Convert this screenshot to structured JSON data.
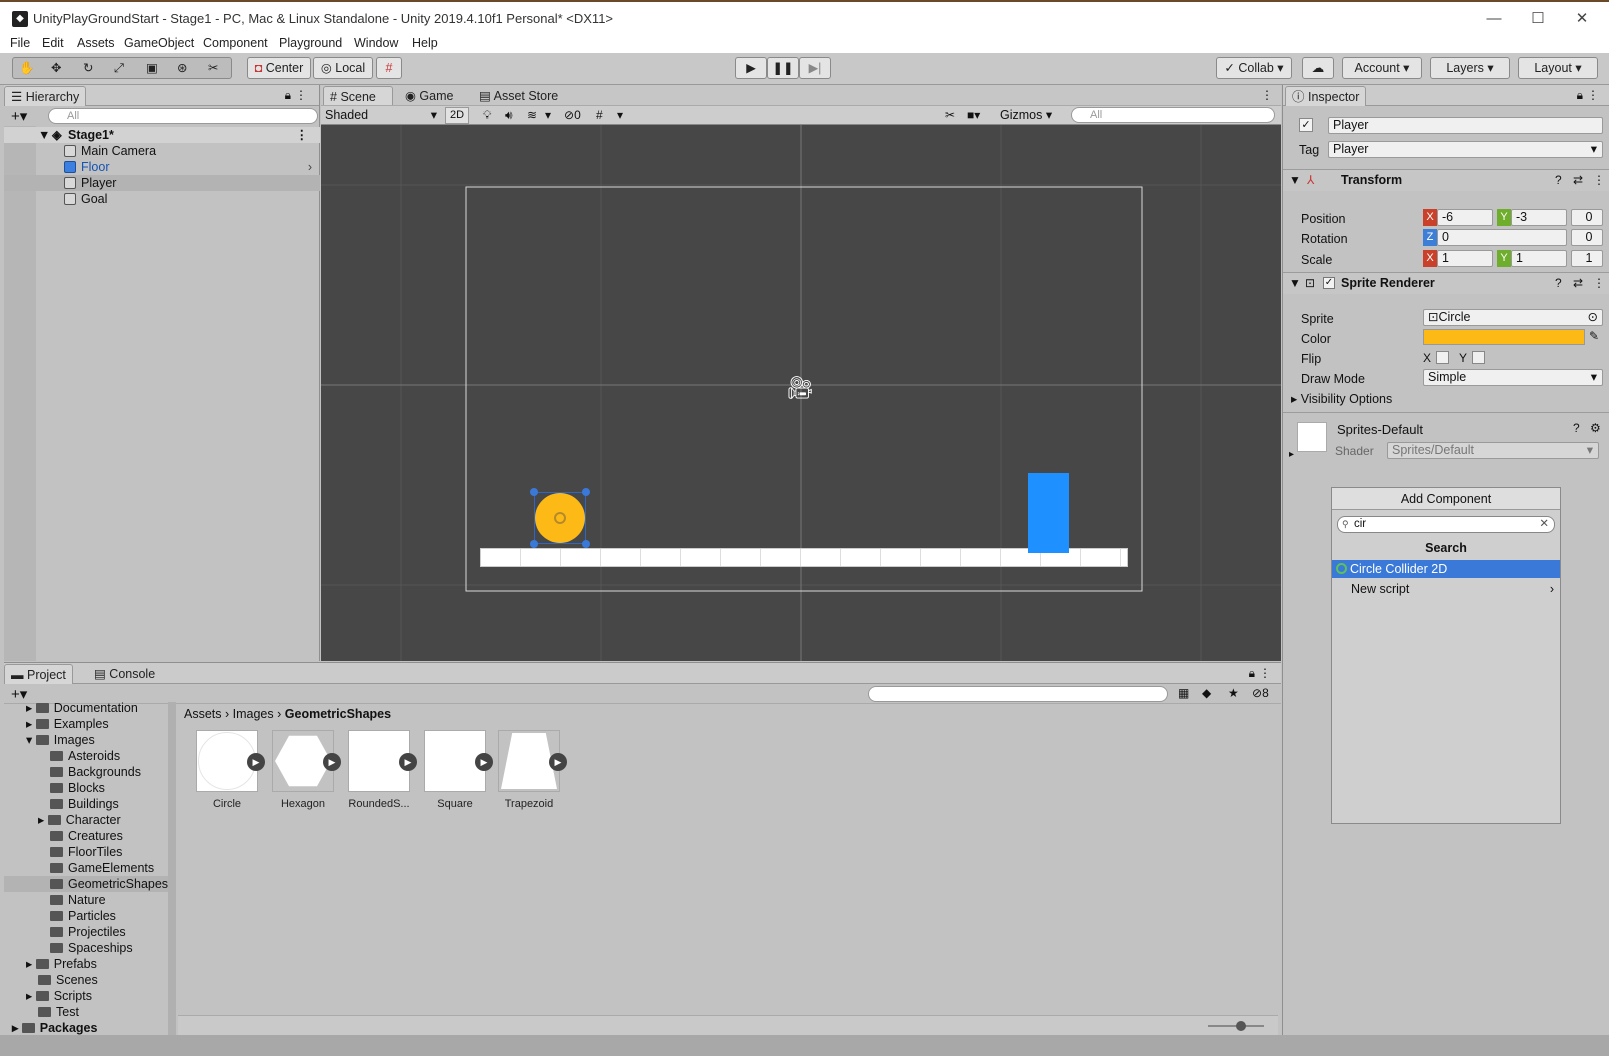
{
  "window": {
    "title": "UnityPlayGroundStart - Stage1 - PC, Mac & Linux Standalone - Unity 2019.4.10f1 Personal* <DX11>",
    "minimize_icon": "minimize-icon",
    "maximize_icon": "maximize-icon",
    "close_icon": "close-icon"
  },
  "menu": [
    "File",
    "Edit",
    "Assets",
    "GameObject",
    "Component",
    "Playground",
    "Window",
    "Help"
  ],
  "toolbar": {
    "pivot": "Center",
    "space": "Local",
    "collab": "Collab",
    "account": "Account",
    "layers": "Layers",
    "layout": "Layout"
  },
  "hierarchy": {
    "tab": "Hierarchy",
    "search_placeholder": "All",
    "scene": "Stage1*",
    "items": [
      "Main Camera",
      "Floor",
      "Player",
      "Goal"
    ]
  },
  "scene_view": {
    "tabs": [
      "Scene",
      "Game",
      "Asset Store"
    ],
    "shading": "Shaded",
    "mode_2d": "2D",
    "hidden_count": "0",
    "gizmos": "Gizmos",
    "search_placeholder": "All"
  },
  "inspector": {
    "tab": "Inspector",
    "object_name": "Player",
    "tag_label": "Tag",
    "tag_value": "Player",
    "transform": {
      "title": "Transform",
      "position_label": "Position",
      "rotation_label": "Rotation",
      "scale_label": "Scale",
      "px": "-6",
      "py": "-3",
      "pz": "0",
      "rz": "0",
      "rz2": "0",
      "sx": "1",
      "sy": "1",
      "sz": "1"
    },
    "sprite_renderer": {
      "title": "Sprite Renderer",
      "sprite_label": "Sprite",
      "sprite_value": "Circle",
      "color_label": "Color",
      "color_value": "#fdb915",
      "flip_label": "Flip",
      "flip_x": "X",
      "flip_y": "Y",
      "draw_mode_label": "Draw Mode",
      "draw_mode_value": "Simple",
      "visibility_label": "Visibility Options"
    },
    "material": {
      "name": "Sprites-Default",
      "shader_label": "Shader",
      "shader_value": "Sprites/Default"
    },
    "add_component": "Add Component",
    "search_value": "cir",
    "search_header": "Search",
    "results": [
      "Circle Collider 2D",
      "New script"
    ]
  },
  "project": {
    "tabs": [
      "Project",
      "Console"
    ],
    "badge_count": "8",
    "breadcrumb": [
      "Assets",
      "Images",
      "GeometricShapes"
    ],
    "tree": [
      "Documentation",
      "Examples",
      "Images",
      "Asteroids",
      "Backgrounds",
      "Blocks",
      "Buildings",
      "Character",
      "Creatures",
      "FloorTiles",
      "GameElements",
      "GeometricShapes",
      "Nature",
      "Particles",
      "Projectiles",
      "Spaceships",
      "Prefabs",
      "Scenes",
      "Scripts",
      "Test",
      "Packages"
    ],
    "assets": [
      "Circle",
      "Hexagon",
      "RoundedS...",
      "Square",
      "Trapezoid"
    ]
  },
  "colors": {
    "selection_blue": "#3a79d8",
    "player_orange": "#fdb915",
    "goal_blue": "#1e90ff",
    "axis_x": "#c9412a",
    "axis_y": "#6fae2c",
    "axis_z": "#3d7fd6"
  }
}
